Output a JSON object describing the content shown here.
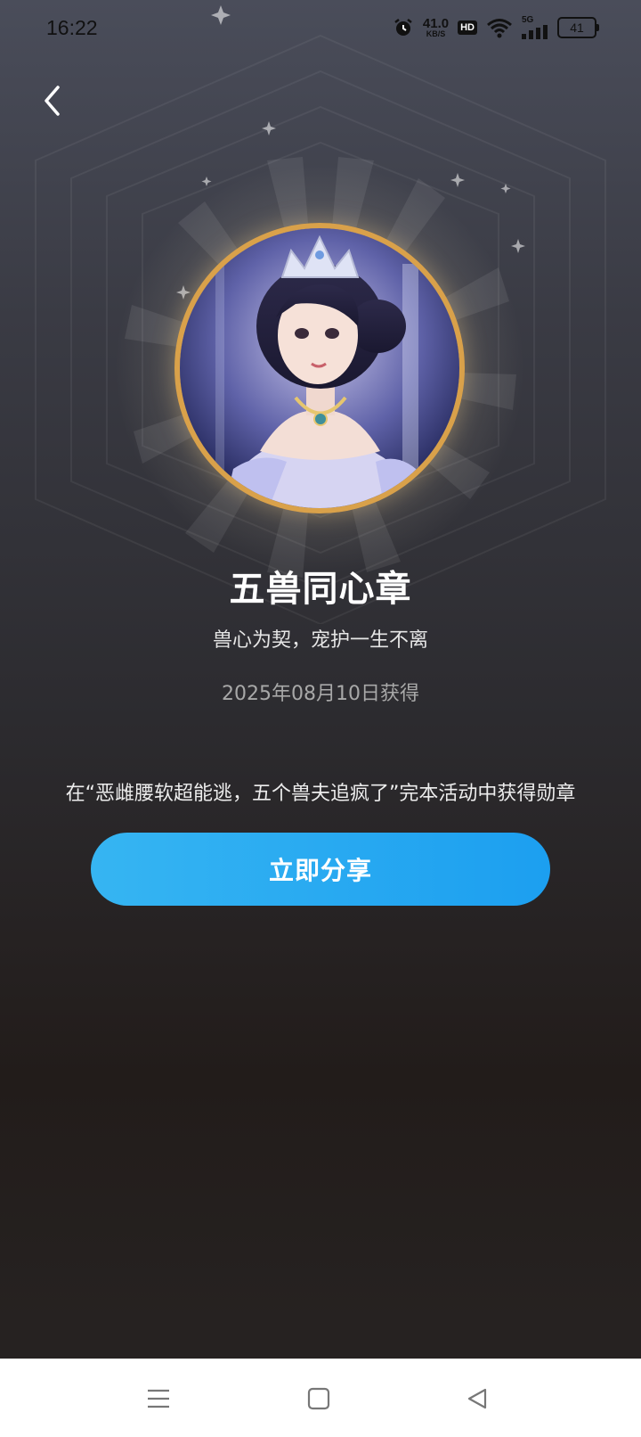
{
  "status_bar": {
    "time": "16:22",
    "net_speed_value": "41.0",
    "net_speed_unit": "KB/S",
    "hd_label": "HD",
    "network_label": "5G",
    "battery": "41"
  },
  "badge": {
    "title": "五兽同心章",
    "subtitle": "兽心为契，宠护一生不离",
    "date": "2025年08月10日获得",
    "description": "在“恶雌腰软超能逃，五个兽夫追疯了”完本活动中获得勋章",
    "share_label": "立即分享",
    "ring_color": "#d9a14a"
  },
  "colors": {
    "accent": "#1c9ff0",
    "background_top": "#4a4d5a",
    "background_bottom": "#272322"
  }
}
